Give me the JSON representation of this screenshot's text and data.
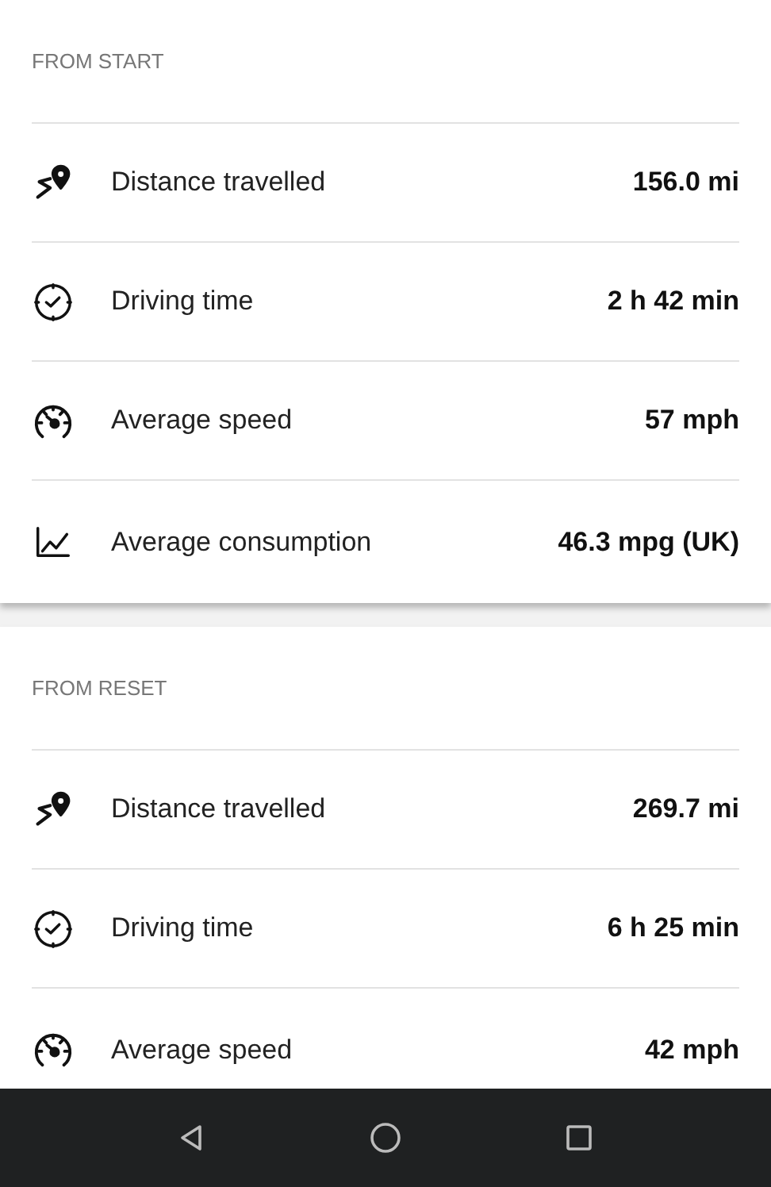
{
  "sections": [
    {
      "title": "FROM START",
      "rows": [
        {
          "kind": "distance",
          "label": "Distance travelled",
          "value": "156.0 mi"
        },
        {
          "kind": "time",
          "label": "Driving time",
          "value": "2 h 42 min"
        },
        {
          "kind": "speed",
          "label": "Average speed",
          "value": "57 mph"
        },
        {
          "kind": "consumption",
          "label": "Average consumption",
          "value": "46.3 mpg (UK)"
        }
      ]
    },
    {
      "title": "FROM RESET",
      "rows": [
        {
          "kind": "distance",
          "label": "Distance travelled",
          "value": "269.7 mi"
        },
        {
          "kind": "time",
          "label": "Driving time",
          "value": "6 h 25 min"
        },
        {
          "kind": "speed",
          "label": "Average speed",
          "value": "42 mph"
        }
      ]
    }
  ]
}
